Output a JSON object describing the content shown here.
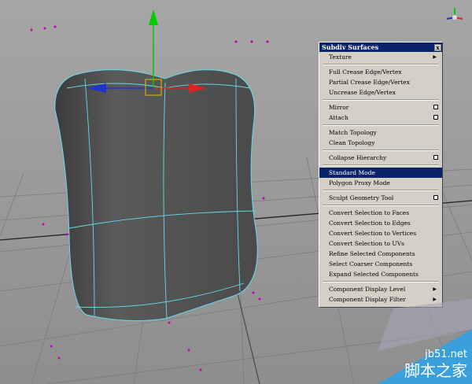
{
  "menu": {
    "title": "Subdiv Surfaces",
    "close_label": "x",
    "items": [
      {
        "label": "Texture"
      },
      {
        "label": "Full Crease Edge/Vertex"
      },
      {
        "label": "Partial Crease Edge/Vertex"
      },
      {
        "label": "Uncrease Edge/Vertex"
      },
      {
        "label": "Mirror"
      },
      {
        "label": "Attach"
      },
      {
        "label": "Match Topology"
      },
      {
        "label": "Clean Topology"
      },
      {
        "label": "Collapse Hierarchy"
      },
      {
        "label": "Standard Mode"
      },
      {
        "label": "Polygon Proxy Mode"
      },
      {
        "label": "Sculpt Geometry Tool"
      },
      {
        "label": "Convert Selection to Faces"
      },
      {
        "label": "Convert Selection to Edges"
      },
      {
        "label": "Convert Selection to Vertices"
      },
      {
        "label": "Convert Selection to UVs"
      },
      {
        "label": "Refine Selected Components"
      },
      {
        "label": "Select Coarser Components"
      },
      {
        "label": "Expand Selected Components"
      },
      {
        "label": "Component Display Level"
      },
      {
        "label": "Component Display Filter"
      }
    ]
  },
  "watermark": {
    "site": "jb51.net",
    "name": "脚本之家"
  },
  "colors": {
    "highlight": "#0a246a",
    "wireframe": "#66d9ef",
    "manip_y": "#00cc00",
    "manip_x": "#dd2222",
    "manip_z": "#2233cc"
  }
}
